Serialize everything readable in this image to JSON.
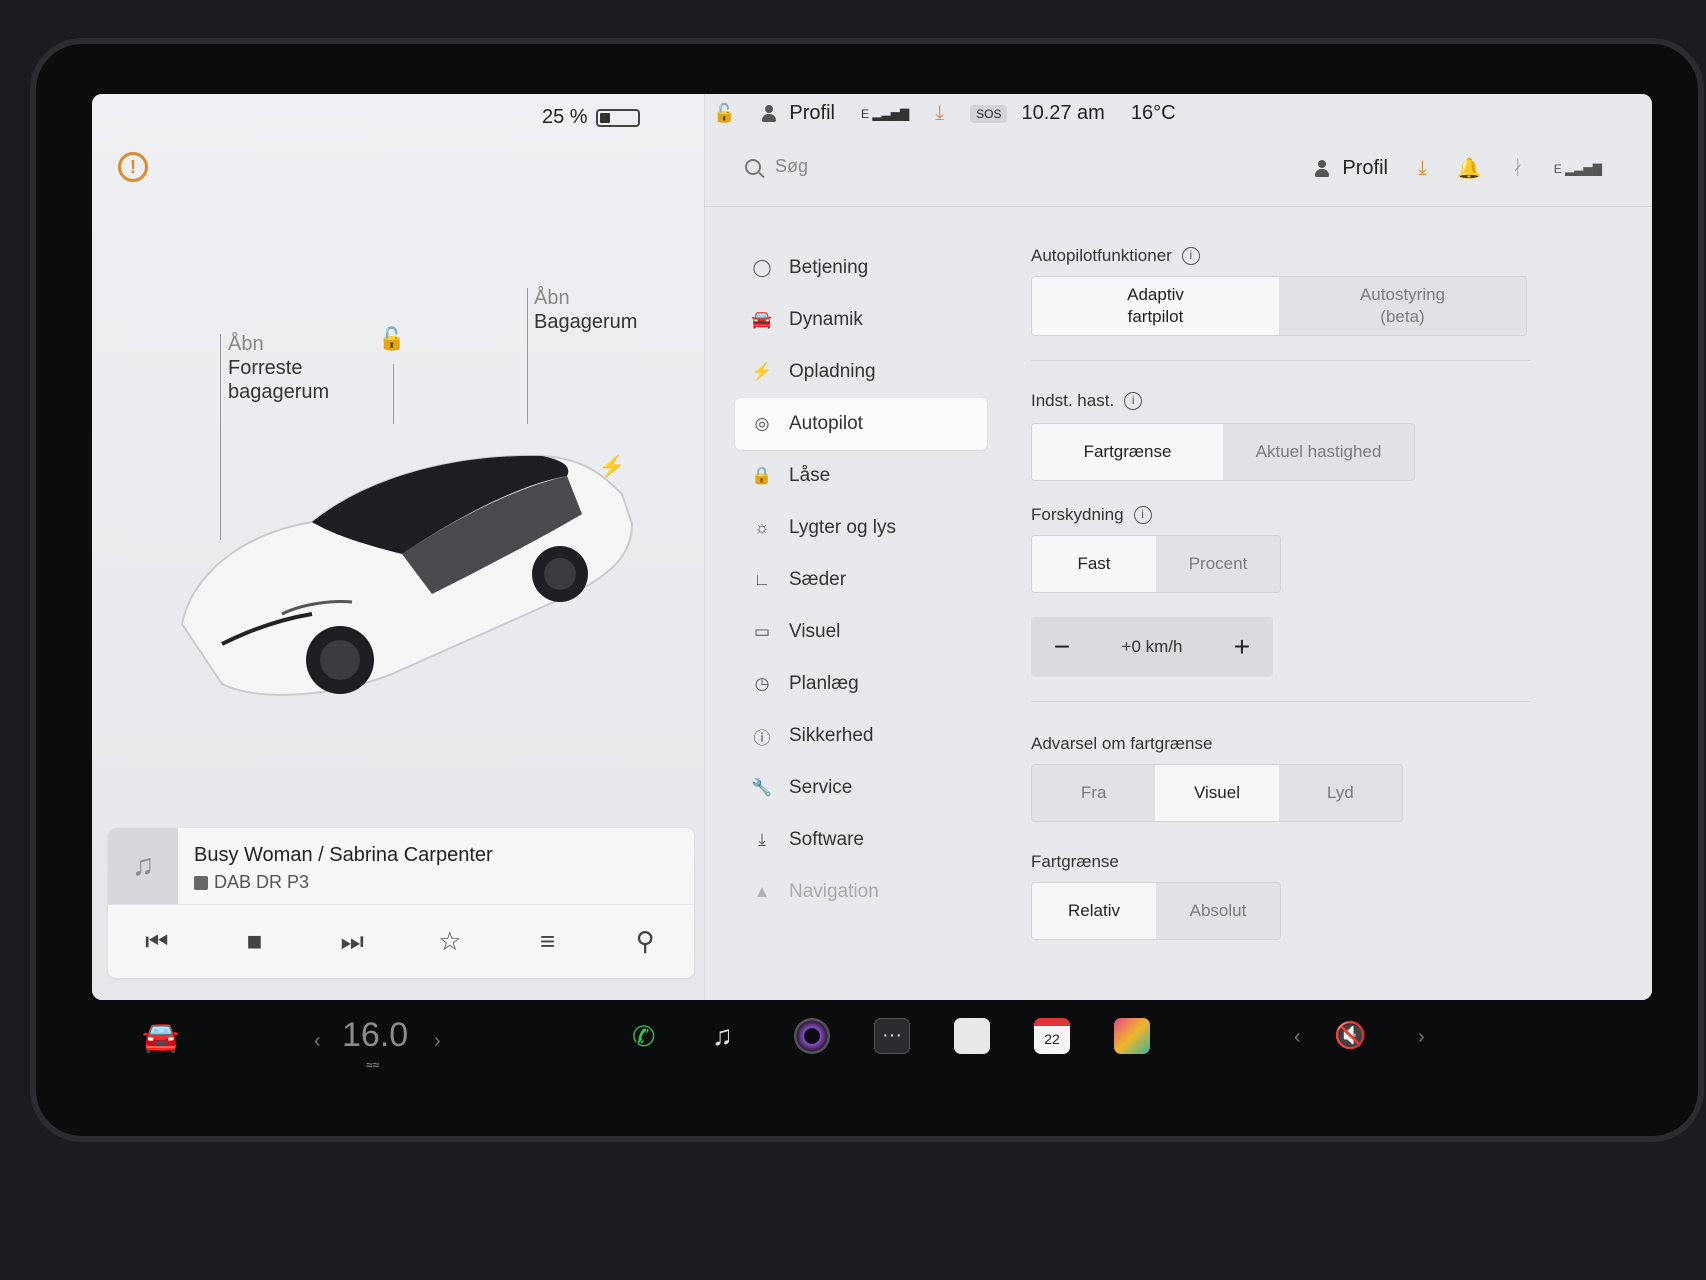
{
  "status_bar": {
    "battery_percent": "25 %",
    "battery_level": 0.25,
    "profile": "Profil",
    "signal_label": "E",
    "sos": "SOS",
    "time": "10.27 am",
    "temperature": "16°C"
  },
  "car_panel": {
    "frunk_label_a": "Åbn",
    "frunk_label_b": "Forreste",
    "frunk_label_c": "bagagerum",
    "trunk_label_a": "Åbn",
    "trunk_label_b": "Bagagerum"
  },
  "media": {
    "song": "Busy Woman / Sabrina Carpenter",
    "station": "DAB DR P3"
  },
  "top": {
    "search_placeholder": "Søg",
    "profile": "Profil",
    "signal_label": "E"
  },
  "nav": {
    "items": [
      {
        "label": "Betjening",
        "icon": "toggle-icon"
      },
      {
        "label": "Dynamik",
        "icon": "car-icon"
      },
      {
        "label": "Opladning",
        "icon": "bolt-icon"
      },
      {
        "label": "Autopilot",
        "icon": "steering-wheel-icon"
      },
      {
        "label": "Låse",
        "icon": "lock-icon"
      },
      {
        "label": "Lygter og lys",
        "icon": "sun-icon"
      },
      {
        "label": "Sæder",
        "icon": "seat-icon"
      },
      {
        "label": "Visuel",
        "icon": "display-icon"
      },
      {
        "label": "Planlæg",
        "icon": "clock-icon"
      },
      {
        "label": "Sikkerhed",
        "icon": "alert-icon"
      },
      {
        "label": "Service",
        "icon": "wrench-icon"
      },
      {
        "label": "Software",
        "icon": "download-icon"
      },
      {
        "label": "Navigation",
        "icon": "navigation-icon"
      }
    ],
    "active": "Autopilot"
  },
  "settings": {
    "autopilot_features": {
      "label": "Autopilotfunktioner",
      "options": [
        "Adaptiv fartpilot",
        "Autostyring (beta)"
      ],
      "opt1_a": "Adaptiv",
      "opt1_b": "fartpilot",
      "opt2_a": "Autostyring",
      "opt2_b": "(beta)",
      "selected": "Adaptiv fartpilot"
    },
    "set_speed": {
      "label": "Indst. hast.",
      "options": [
        "Fartgrænse",
        "Aktuel hastighed"
      ],
      "selected": "Fartgrænse"
    },
    "offset": {
      "label": "Forskydning",
      "options": [
        "Fast",
        "Procent"
      ],
      "selected": "Fast",
      "value": "+0 km/h"
    },
    "speed_warning": {
      "label": "Advarsel om fartgrænse",
      "options": [
        "Fra",
        "Visuel",
        "Lyd"
      ],
      "selected": "Visuel"
    },
    "speed_limit": {
      "label": "Fartgrænse",
      "options": [
        "Relativ",
        "Absolut"
      ],
      "selected": "Relativ"
    }
  },
  "dock": {
    "temperature": "16.0",
    "calendar_day": "22"
  },
  "colors": {
    "accent_orange": "#e08a2e",
    "phone_green": "#2ec44a",
    "calendar_red": "#e0333a"
  }
}
